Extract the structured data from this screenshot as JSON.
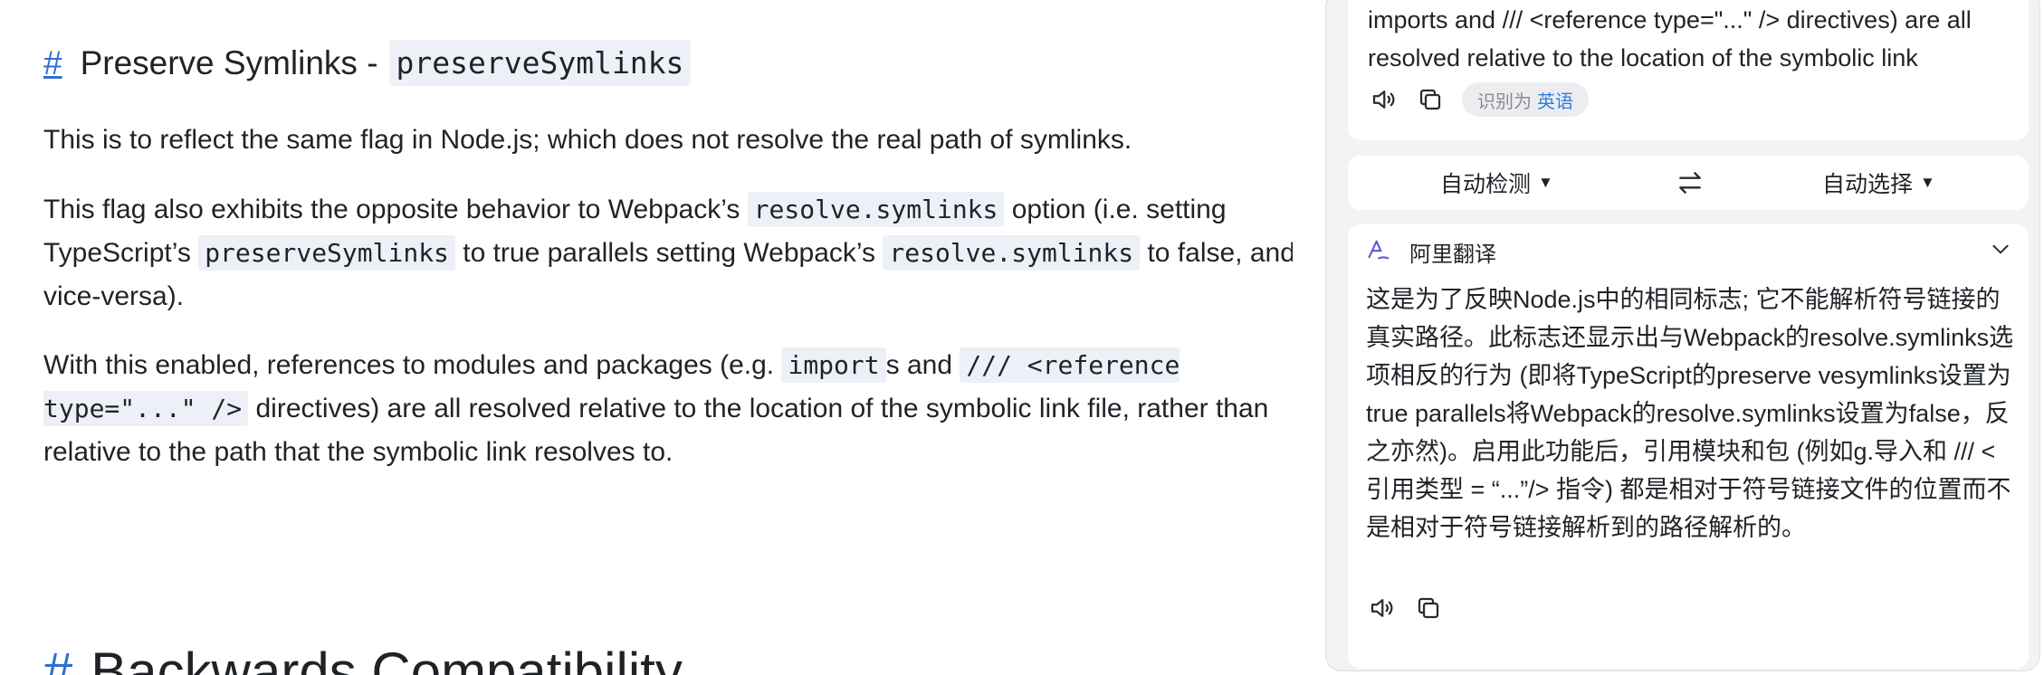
{
  "doc": {
    "section1": {
      "anchor": "#",
      "title": "Preserve Symlinks - ",
      "code": "preserveSymlinks"
    },
    "p1": "This is to reflect the same flag in Node.js; which does not resolve the real path of symlinks.",
    "p2": {
      "t1": "This flag also exhibits the opposite behavior to Webpack’s ",
      "c1": "resolve.symlinks",
      "t2": " option (i.e. setting TypeScript’s ",
      "c2": "preserveSymlinks",
      "t3": " to true parallels setting Webpack’s ",
      "c3": "resolve.symlinks",
      "t4": " to false, and vice-versa)."
    },
    "p3": {
      "t1": "With this enabled, references to modules and packages (e.g. ",
      "c1": "import",
      "t2": "s and ",
      "c2": "/// <reference type=\"...\" />",
      "t3": " directives) are all resolved relative to the location of the symbolic link file, rather than relative to the path that the symbolic link resolves to."
    },
    "section2": {
      "anchor": "#",
      "title": "Backwards Compatibility"
    }
  },
  "translator": {
    "source_text": "imports and /// <reference type=\"...\" /> directives) are all resolved relative to the location of the symbolic link",
    "detected_prefix": "识别为",
    "detected_lang": "英语",
    "from_lang": "自动检测",
    "to_lang": "自动选择",
    "engine": "阿里翻译",
    "result": "这是为了反映Node.js中的相同标志; 它不能解析符号链接的真实路径。此标志还显示出与Webpack的resolve.symlinks选项相反的行为 (即将TypeScript的preserve vesymlinks设置为true parallels将Webpack的resolve.symlinks设置为false，反之亦然)。启用此功能后，引用模块和包 (例如g.导入和 /// <引用类型 = “...”/> 指令) 都是相对于符号链接文件的位置而不是相对于符号链接解析到的路径解析的。",
    "icons": {
      "speaker": "speaker-icon",
      "copy": "copy-icon",
      "swap": "swap-arrows-icon",
      "engine": "ali-translate-icon",
      "collapse": "chevron-down-icon"
    },
    "accent_color": "#2f7de1"
  }
}
